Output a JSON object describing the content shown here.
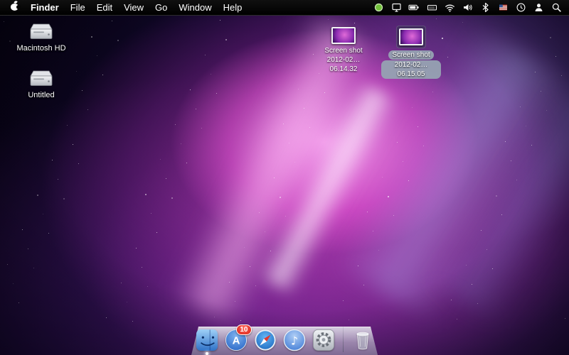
{
  "menu_bar": {
    "apple_menu_icon": "apple-icon",
    "app_name": "Finder",
    "menus": [
      "File",
      "Edit",
      "View",
      "Go",
      "Window",
      "Help"
    ],
    "status_icons": [
      "green-status-icon",
      "display-icon",
      "battery-icon",
      "keyboard-icon",
      "wifi-icon",
      "volume-icon",
      "bluetooth-icon",
      "flag-icon",
      "clock-icon",
      "user-icon",
      "spotlight-icon"
    ]
  },
  "desktop_icons": {
    "macintosh_hd": {
      "icon": "hard-drive-icon",
      "label": "Macintosh HD",
      "selected": false
    },
    "untitled": {
      "icon": "hard-drive-icon",
      "label": "Untitled",
      "selected": false
    },
    "screenshot_1": {
      "icon": "image-file-icon",
      "label_line1": "Screen shot",
      "label_line2": "2012-02…06.14.32",
      "selected": false
    },
    "screenshot_2": {
      "icon": "image-file-icon",
      "label_line1": "Screen shot",
      "label_line2": "2012-02…06.15.05",
      "selected": true
    }
  },
  "dock": {
    "items": [
      {
        "icon": "finder-icon",
        "running": true
      },
      {
        "icon": "app-store-icon",
        "badge": "10"
      },
      {
        "icon": "safari-icon"
      },
      {
        "icon": "itunes-icon"
      },
      {
        "icon": "system-preferences-icon"
      },
      {
        "icon": "trash-icon"
      }
    ]
  }
}
